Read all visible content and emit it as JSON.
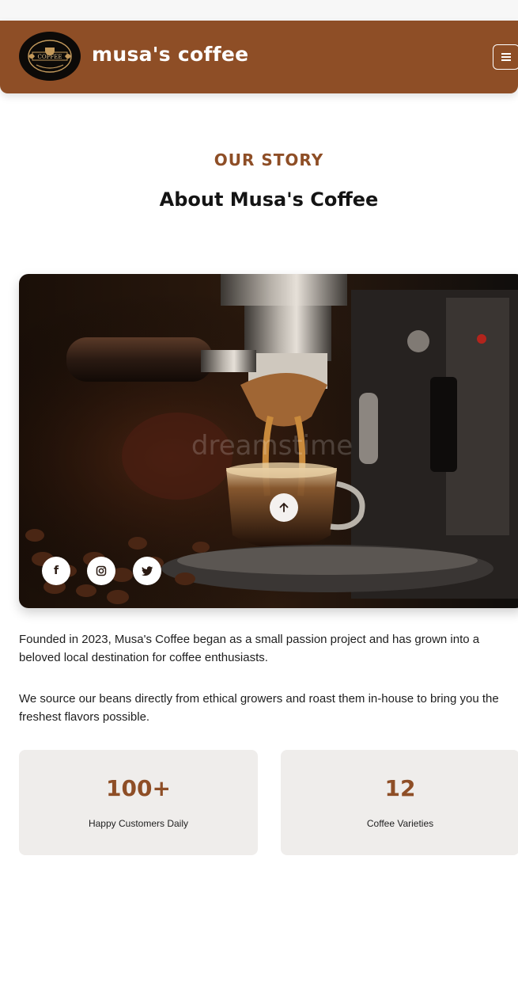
{
  "header": {
    "brand": "musa's coffee",
    "logo_text": "COFFEE",
    "menu_icon": "menu-icon"
  },
  "about": {
    "eyebrow": "OUR STORY",
    "title": "About Musa's Coffee",
    "watermark": "dreamstime",
    "paragraphs": [
      "Founded in 2023, Musa's Coffee began as a small passion project and has grown into a beloved local destination for coffee enthusiasts.",
      "We source our beans directly from ethical growers and roast them in-house to bring you the freshest flavors possible."
    ]
  },
  "social": [
    {
      "icon": "facebook-icon",
      "glyph": "f"
    },
    {
      "icon": "instagram-icon",
      "glyph": ""
    },
    {
      "icon": "twitter-icon",
      "glyph": ""
    }
  ],
  "stats": [
    {
      "value": "100+",
      "label": "Happy Customers Daily"
    },
    {
      "value": "12",
      "label": "Coffee Varieties"
    }
  ],
  "colors": {
    "brand": "#8e4e26",
    "stat_bg": "#efedeb",
    "header_text": "#ffffff"
  }
}
